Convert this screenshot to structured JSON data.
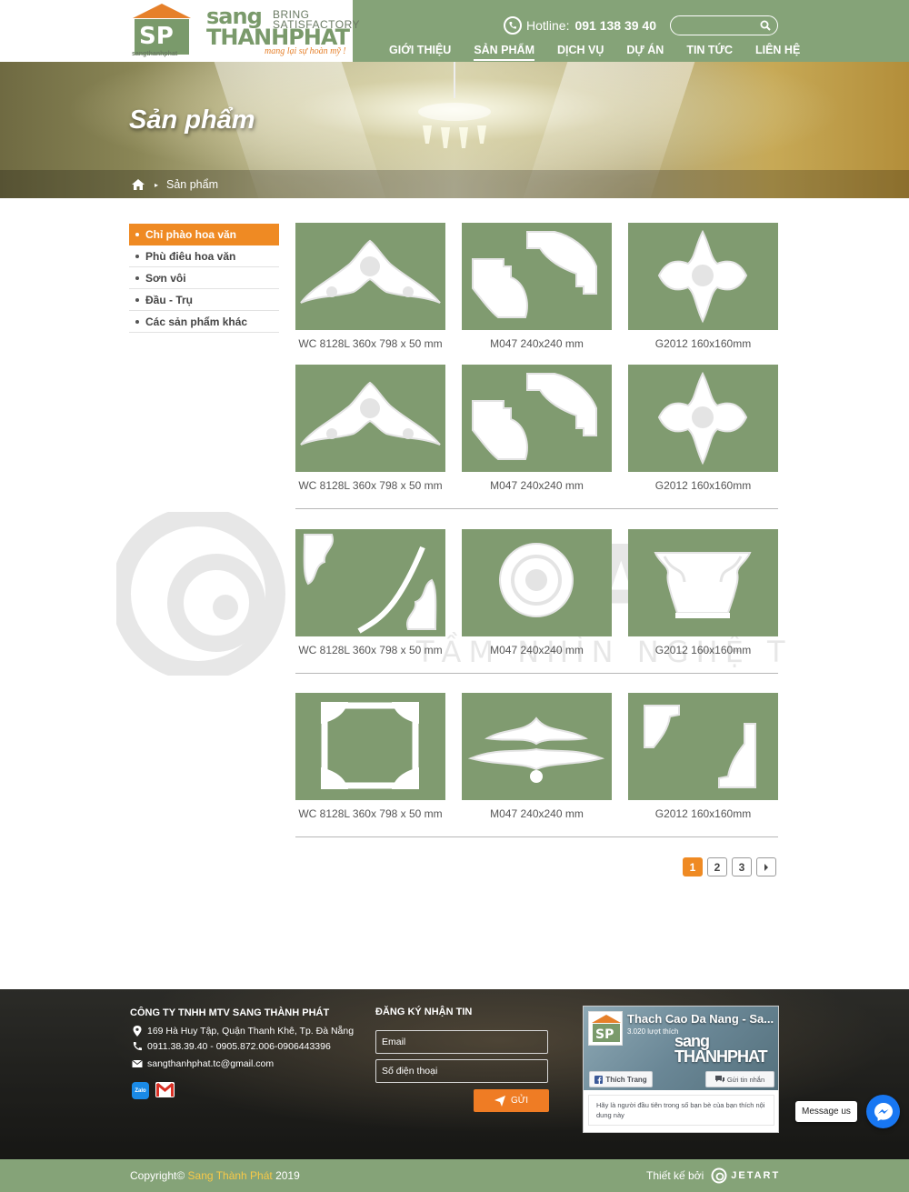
{
  "logo": {
    "brand_line1": "sang",
    "brand_line2": "THANHPHAT",
    "slogan_line1": "BRING",
    "slogan_line2": "SATISFACTORY",
    "tagline": "mang lại sự hoàn mỹ !",
    "mark_caption": "sangthanhphat"
  },
  "header": {
    "hotline_label": "Hotline:",
    "hotline_number": "091 138 39 40",
    "search_placeholder": "",
    "accent_color": "#85a378",
    "nav": [
      {
        "label": "GIỚI THIỆU",
        "active": false
      },
      {
        "label": "SẢN PHẨM",
        "active": true
      },
      {
        "label": "DỊCH VỤ",
        "active": false
      },
      {
        "label": "DỰ ÁN",
        "active": false
      },
      {
        "label": "TIN TỨC",
        "active": false
      },
      {
        "label": "LIÊN HỆ",
        "active": false
      }
    ]
  },
  "banner": {
    "title": "Sản phẩm",
    "breadcrumb": {
      "home_icon": "home-icon",
      "current": "Sản phẩm"
    }
  },
  "sidebar": {
    "highlight_color": "#ef8a23",
    "categories": [
      {
        "label": "Chỉ phào hoa văn",
        "active": true
      },
      {
        "label": "Phù điêu hoa văn",
        "active": false
      },
      {
        "label": "Sơn vôi",
        "active": false
      },
      {
        "label": "Đầu - Trụ",
        "active": false
      },
      {
        "label": "Các sản phẩm khác",
        "active": false
      }
    ]
  },
  "products": [
    {
      "caption": "WC 8128L 360x 798 x 50 mm",
      "shape": "arch-ornament"
    },
    {
      "caption": "M047 240x240 mm",
      "shape": "corner-pair"
    },
    {
      "caption": "G2012 160x160mm",
      "shape": "cross-ornament"
    },
    {
      "caption": "WC 8128L 360x 798 x 50 mm",
      "shape": "arch-ornament"
    },
    {
      "caption": "M047 240x240 mm",
      "shape": "corner-pair"
    },
    {
      "caption": "G2012 160x160mm",
      "shape": "cross-ornament"
    },
    {
      "caption": "WC 8128L 360x 798 x 50 mm",
      "shape": "scroll-corners"
    },
    {
      "caption": "M047 240x240 mm",
      "shape": "ceiling-medallion"
    },
    {
      "caption": "G2012 160x160mm",
      "shape": "column-capital"
    },
    {
      "caption": "WC 8128L 360x 798 x 50 mm",
      "shape": "frame-corners"
    },
    {
      "caption": "M047 240x240 mm",
      "shape": "horizontal-ornaments"
    },
    {
      "caption": "G2012 160x160mm",
      "shape": "corner-pair-2"
    }
  ],
  "watermark": {
    "word": "JETART",
    "subtitle": "TẦM NHÌN NGHỆ THUẬT"
  },
  "pagination": {
    "pages": [
      "1",
      "2",
      "3"
    ],
    "current": "1",
    "next_icon": "chevron-right-icon"
  },
  "footer": {
    "company_name": "CÔNG TY TNHH MTV SANG THÀNH PHÁT",
    "address": "169 Hà Huy Tập,  Quận Thanh Khê, Tp. Đà Nẵng",
    "phones": "0911.38.39.40 - 0905.872.006-0906443396",
    "email": "sangthanhphat.tc@gmail.com",
    "zalo_label": "Zalo",
    "newsletter_title": "ĐĂNG KÝ NHẬN TIN",
    "email_placeholder": "Email",
    "phone_placeholder": "Số điện thoại",
    "send_label": "GỬI",
    "fb": {
      "page_name": "Thach Cao Da Nang - Sa...",
      "likes": "3.020 lượt thích",
      "cover_brand_1": "sang",
      "cover_brand_2": "THANHPHAT",
      "like_label": "Thích Trang",
      "message_label": "Gửi tin nhắn",
      "friends_note": "Hãy là người đầu tiên trong số bạn bè của bạn thích nội dung này"
    }
  },
  "copyright": {
    "prefix": "Copyright©",
    "brand": "Sang Thành Phát",
    "year": "2019",
    "designed_by": "Thiết kế bởi",
    "designer": "JETART"
  },
  "messenger": {
    "label": "Message us"
  }
}
